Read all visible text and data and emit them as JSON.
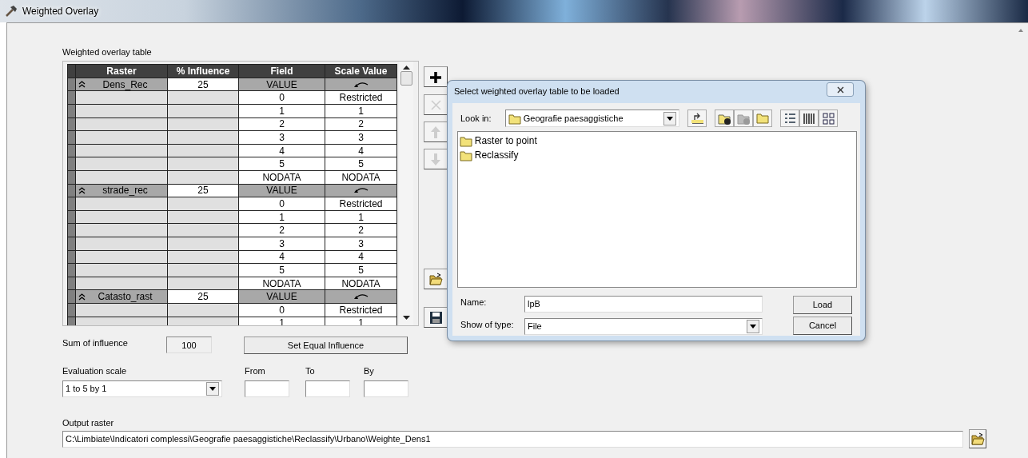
{
  "window": {
    "title": "Weighted Overlay"
  },
  "table": {
    "label": "Weighted overlay table",
    "columns": [
      "Raster",
      "% Influence",
      "Field",
      "Scale Value"
    ],
    "groups": [
      {
        "raster": "Dens_Rec",
        "influence": "25",
        "field": "VALUE",
        "rows": [
          {
            "field": "0",
            "scale": "Restricted"
          },
          {
            "field": "1",
            "scale": "1"
          },
          {
            "field": "2",
            "scale": "2"
          },
          {
            "field": "3",
            "scale": "3"
          },
          {
            "field": "4",
            "scale": "4"
          },
          {
            "field": "5",
            "scale": "5"
          },
          {
            "field": "NODATA",
            "scale": "NODATA"
          }
        ]
      },
      {
        "raster": "strade_rec",
        "influence": "25",
        "field": "VALUE",
        "rows": [
          {
            "field": "0",
            "scale": "Restricted"
          },
          {
            "field": "1",
            "scale": "1"
          },
          {
            "field": "2",
            "scale": "2"
          },
          {
            "field": "3",
            "scale": "3"
          },
          {
            "field": "4",
            "scale": "4"
          },
          {
            "field": "5",
            "scale": "5"
          },
          {
            "field": "NODATA",
            "scale": "NODATA"
          }
        ]
      },
      {
        "raster": "Catasto_rast",
        "influence": "25",
        "field": "VALUE",
        "rows": [
          {
            "field": "0",
            "scale": "Restricted"
          },
          {
            "field": "1",
            "scale": "1"
          }
        ]
      }
    ]
  },
  "side_buttons": [
    {
      "kind": "add",
      "disabled": false
    },
    {
      "kind": "remove",
      "disabled": true
    },
    {
      "kind": "up",
      "disabled": true
    },
    {
      "kind": "down",
      "disabled": true
    },
    {
      "kind": "open",
      "disabled": false
    },
    {
      "kind": "save",
      "disabled": false
    }
  ],
  "sum_of_influence": {
    "label": "Sum of influence",
    "value": "100"
  },
  "set_equal_button": "Set Equal Influence",
  "evaluation_scale": {
    "label": "Evaluation scale",
    "value": "1 to 5 by 1"
  },
  "range_fields": [
    {
      "label": "From"
    },
    {
      "label": "To"
    },
    {
      "label": "By"
    }
  ],
  "output_raster": {
    "label": "Output raster",
    "value": "C:\\Limbiate\\Indicatori complessi\\Geografie paesaggistiche\\Reclassify\\Urbano\\Weighte_Dens1"
  },
  "dialog": {
    "title": "Select weighted overlay table to be loaded",
    "look_in": {
      "label": "Look in:",
      "value": "Geografie paesaggistiche"
    },
    "files": [
      {
        "name": "Raster to point"
      },
      {
        "name": "Reclassify"
      }
    ],
    "name_field": {
      "label": "Name:",
      "value": "lpB"
    },
    "type_field": {
      "label": "Show of type:",
      "value": "File"
    },
    "buttons": [
      "Load",
      "Cancel"
    ]
  }
}
